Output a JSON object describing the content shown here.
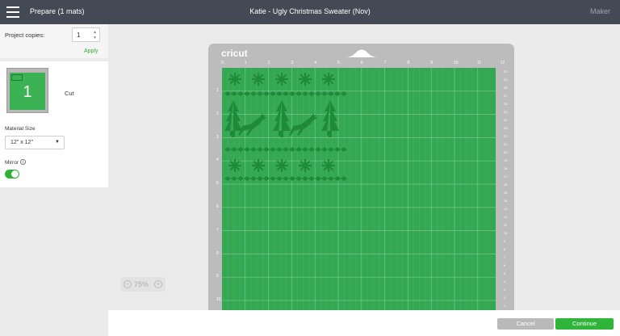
{
  "topbar": {
    "prepare_label": "Prepare (1 mats)",
    "title": "Katie - Ugly Christmas Sweater (Nov)",
    "maker_label": "Maker"
  },
  "left_panel": {
    "project_copies_label": "Project copies:",
    "project_copies_value": "1",
    "apply_label": "Apply",
    "mat_number": "1",
    "cut_label": "Cut",
    "material_size_label": "Material Size",
    "material_size_value": "12\" x 12\"",
    "mirror_label": "Mirror",
    "mirror_on": true
  },
  "zoom": {
    "value": "75%"
  },
  "mat": {
    "brand": "cricut",
    "col_numbers": [
      "0",
      "1",
      "2",
      "3",
      "4",
      "5",
      "6",
      "7",
      "8",
      "9",
      "10",
      "11",
      "12"
    ],
    "row_numbers": [
      "1",
      "2",
      "3",
      "4",
      "5",
      "6",
      "7",
      "8",
      "9",
      "10"
    ],
    "right_numbers": [
      "30",
      "29",
      "28",
      "27",
      "26",
      "25",
      "24",
      "23",
      "22",
      "21",
      "20",
      "19",
      "18",
      "17",
      "16",
      "15",
      "14",
      "13",
      "12",
      "11",
      "10",
      "9",
      "8",
      "7",
      "6",
      "5",
      "4",
      "3",
      "2",
      "1"
    ]
  },
  "bottombar": {
    "cancel_label": "Cancel",
    "continue_label": "Continue"
  },
  "colors": {
    "topbar_bg": "#434a55",
    "accent_green": "#2eb135",
    "mat_green": "#34a853",
    "design_green": "#1f8a3a",
    "mat_border": "#bcbcbc"
  }
}
